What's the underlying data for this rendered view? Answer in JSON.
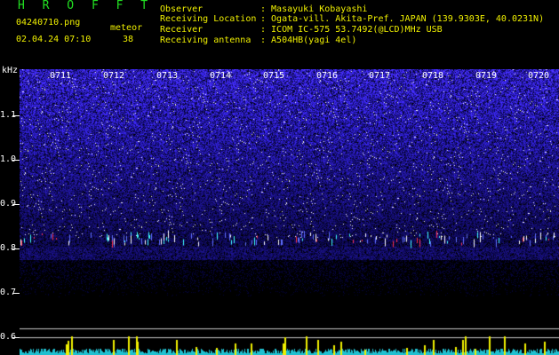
{
  "header": {
    "brand": "H R O F F T",
    "filename": "04240710.png",
    "datetime": "02.04.24 07:10",
    "meteor_label": "meteor",
    "meteor_count": "38",
    "info": [
      {
        "label": "Observer",
        "value": ": Masayuki Kobayashi"
      },
      {
        "label": "Receiving Location",
        "value": ": Ogata-vill. Akita-Pref. JAPAN (139.9303E, 40.0231N)"
      },
      {
        "label": "Receiver",
        "value": ": ICOM IC-575 53.7492(@LCD)MHz USB"
      },
      {
        "label": "Receiving antenna",
        "value": ": A504HB(yagi 4el)"
      }
    ]
  },
  "axis": {
    "unit": "kHz",
    "y_labels": [
      "1.1",
      "1.0",
      "0.9",
      "0.8",
      "0.7",
      "0.6"
    ],
    "x_labels": [
      "0711",
      "0712",
      "0713",
      "0714",
      "0715",
      "0716",
      "0717",
      "0718",
      "0719",
      "0720"
    ]
  },
  "colors": {
    "background": "#000000",
    "brand": "#22e022",
    "header_text": "#f0f000",
    "noise": "#2a2ad0",
    "band_line": "#ffffff"
  }
}
